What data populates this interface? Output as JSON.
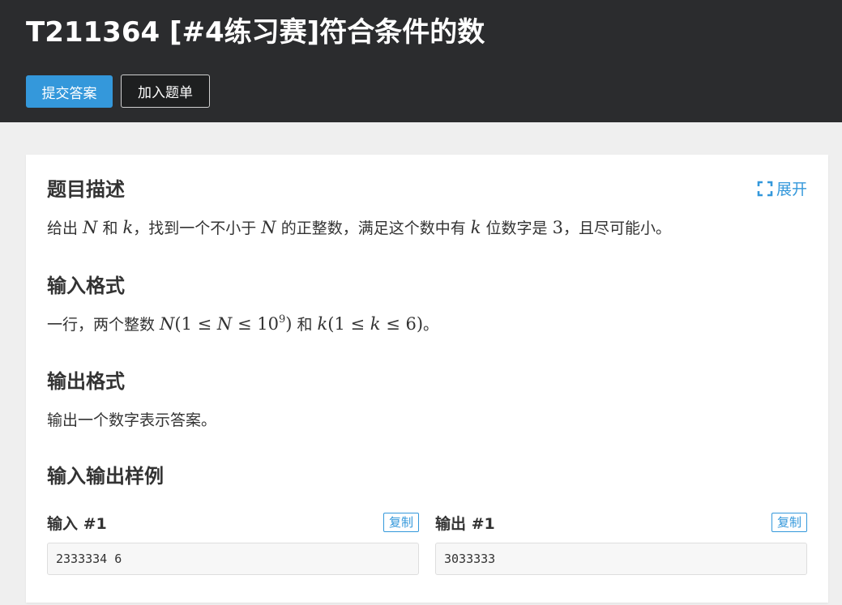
{
  "header": {
    "title": "T211364 [#4练习赛]符合条件的数",
    "submit_label": "提交答案",
    "add_list_label": "加入题单"
  },
  "card": {
    "expand_label": "展开",
    "description": {
      "title": "题目描述",
      "t1": "给出 ",
      "m1": "N",
      "t2": " 和 ",
      "m2": "k",
      "t3": "，找到一个不小于 ",
      "m3": "N",
      "t4": " 的正整数，满足这个数中有 ",
      "m4": "k",
      "t5": " 位数字是 ",
      "m5": "3",
      "t6": "，且尽可能小。"
    },
    "input_format": {
      "title": "输入格式",
      "t1": "一行，两个整数 ",
      "m1_var": "N",
      "m1_a": "(1 ≤ ",
      "m1_b": "N",
      "m1_c": " ≤ 10",
      "m1_exp": "9",
      "m1_d": ")",
      "t2": " 和 ",
      "m2_var": "k",
      "m2_a": "(1 ≤ ",
      "m2_b": "k",
      "m2_c": " ≤ 6)",
      "t3": "。"
    },
    "output_format": {
      "title": "输出格式",
      "text": "输出一个数字表示答案。"
    },
    "samples": {
      "title": "输入输出样例",
      "input_label": "输入 #1",
      "output_label": "输出 #1",
      "copy_label": "复制",
      "input_value": "2333334 6",
      "output_value": "3033333"
    }
  },
  "colors": {
    "accent": "#3498db",
    "header_bg": "#2b2c2e",
    "page_bg": "#efefef"
  }
}
